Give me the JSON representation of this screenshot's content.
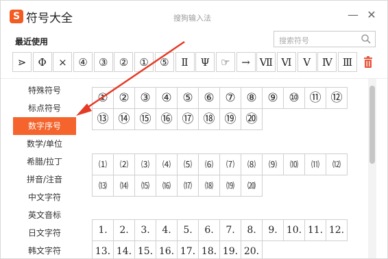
{
  "app": {
    "logo": "S",
    "title": "符号大全",
    "subtitle": "搜狗输入法"
  },
  "window_buttons": {
    "minimize": "—",
    "close": "✕"
  },
  "recent": {
    "label": "最近使用",
    "items": [
      "⋗",
      "Φ",
      "×",
      "④",
      "③",
      "②",
      "①",
      "⑤",
      "Ⅱ",
      "Ψ",
      "☞",
      "→",
      "Ⅶ",
      "Ⅵ",
      "Ⅴ",
      "Ⅳ",
      "Ⅲ"
    ]
  },
  "search": {
    "placeholder": "搜索符号"
  },
  "sidebar": {
    "items": [
      {
        "label": "特殊符号"
      },
      {
        "label": "标点符号"
      },
      {
        "label": "数字序号"
      },
      {
        "label": "数学/单位"
      },
      {
        "label": "希腊/拉丁"
      },
      {
        "label": "拼音/注音"
      },
      {
        "label": "中文字符"
      },
      {
        "label": "英文音标"
      },
      {
        "label": "日文字符"
      },
      {
        "label": "韩文字符"
      }
    ],
    "active_index": 2
  },
  "grids": {
    "circled": {
      "row1": [
        "①",
        "②",
        "③",
        "④",
        "⑤",
        "⑥",
        "⑦",
        "⑧",
        "⑨",
        "⑩",
        "⑪",
        "⑫"
      ],
      "row2": [
        "⑬",
        "⑭",
        "⑮",
        "⑯",
        "⑰",
        "⑱",
        "⑲",
        "⑳"
      ]
    },
    "parenthesized": {
      "row1": [
        "⑴",
        "⑵",
        "⑶",
        "⑷",
        "⑸",
        "⑹",
        "⑺",
        "⑻",
        "⑼",
        "⑽",
        "⑾",
        "⑿"
      ],
      "row2": [
        "⒀",
        "⒁",
        "⒂",
        "⒃",
        "⒄",
        "⒅",
        "⒆",
        "⒇"
      ]
    },
    "period": {
      "row1": [
        "1.",
        "2.",
        "3.",
        "4.",
        "5.",
        "6.",
        "7.",
        "8.",
        "9.",
        "10.",
        "11.",
        "12."
      ],
      "row2": [
        "13.",
        "14.",
        "15.",
        "16.",
        "17.",
        "18.",
        "19.",
        "20."
      ]
    }
  },
  "colors": {
    "accent": "#f4642c",
    "annotation_arrow": "#e53a24"
  }
}
